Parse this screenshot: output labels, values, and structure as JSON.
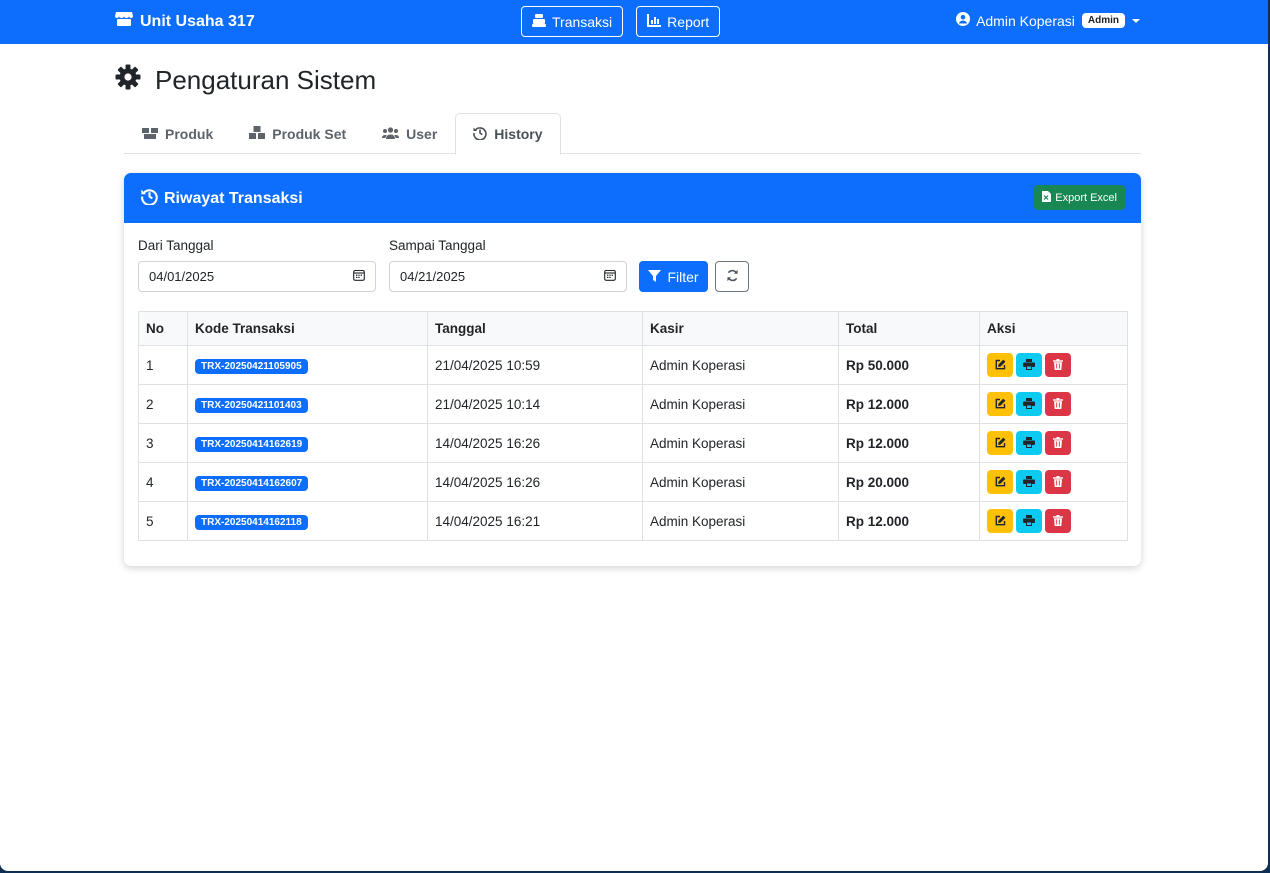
{
  "navbar": {
    "brand": "Unit Usaha 317",
    "transaksi_label": "Transaksi",
    "report_label": "Report",
    "user_name": "Admin Koperasi",
    "role_badge": "Admin"
  },
  "page": {
    "title": "Pengaturan Sistem"
  },
  "tabs": [
    {
      "label": "Produk",
      "icon": "boxes-icon"
    },
    {
      "label": "Produk Set",
      "icon": "cubes-icon"
    },
    {
      "label": "User",
      "icon": "users-icon"
    },
    {
      "label": "History",
      "icon": "history-icon",
      "active": true
    }
  ],
  "card": {
    "title": "Riwayat Transaksi",
    "export_label": "Export Excel"
  },
  "filters": {
    "from_label": "Dari Tanggal",
    "from_value": "04/01/2025",
    "to_label": "Sampai Tanggal",
    "to_value": "04/21/2025",
    "filter_label": "Filter"
  },
  "table": {
    "headers": [
      "No",
      "Kode Transaksi",
      "Tanggal",
      "Kasir",
      "Total",
      "Aksi"
    ],
    "rows": [
      {
        "no": "1",
        "code": "TRX-20250421105905",
        "date": "21/04/2025 10:59",
        "cashier": "Admin Koperasi",
        "total": "Rp 50.000"
      },
      {
        "no": "2",
        "code": "TRX-20250421101403",
        "date": "21/04/2025 10:14",
        "cashier": "Admin Koperasi",
        "total": "Rp 12.000"
      },
      {
        "no": "3",
        "code": "TRX-20250414162619",
        "date": "14/04/2025 16:26",
        "cashier": "Admin Koperasi",
        "total": "Rp 12.000"
      },
      {
        "no": "4",
        "code": "TRX-20250414162607",
        "date": "14/04/2025 16:26",
        "cashier": "Admin Koperasi",
        "total": "Rp 20.000"
      },
      {
        "no": "5",
        "code": "TRX-20250414162118",
        "date": "14/04/2025 16:21",
        "cashier": "Admin Koperasi",
        "total": "Rp 12.000"
      }
    ]
  },
  "colors": {
    "primary": "#0d6efd",
    "success": "#198754",
    "warning": "#ffc107",
    "info": "#0dcaf0",
    "danger": "#dc3545"
  }
}
